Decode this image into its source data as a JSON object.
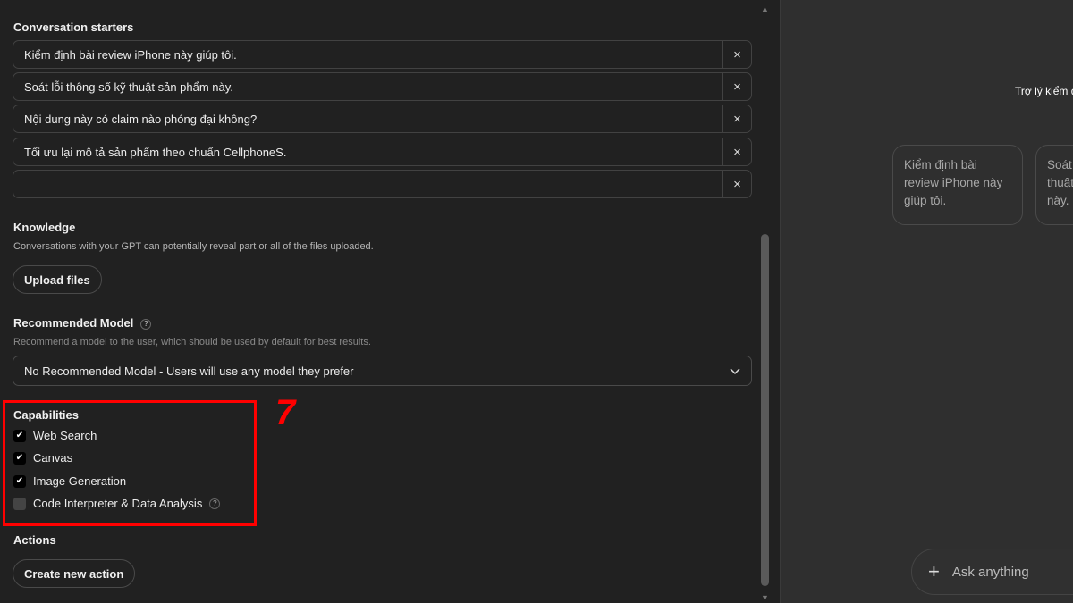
{
  "starters": {
    "heading": "Conversation starters",
    "items": [
      "Kiểm định bài review iPhone này giúp tôi.",
      "Soát lỗi thông số kỹ thuật sản phẩm này.",
      "Nội dung này có claim nào phóng đại không?",
      "Tối ưu lại mô tả sản phẩm theo chuẩn CellphoneS.",
      ""
    ],
    "remove_icon": "×"
  },
  "knowledge": {
    "heading": "Knowledge",
    "description": "Conversations with your GPT can potentially reveal part or all of the files uploaded.",
    "upload_label": "Upload files"
  },
  "model": {
    "heading": "Recommended Model",
    "description": "Recommend a model to the user, which should be used by default for best results.",
    "selected": "No Recommended Model - Users will use any model they prefer"
  },
  "capabilities": {
    "heading": "Capabilities",
    "items": [
      {
        "label": "Web Search",
        "checked": true
      },
      {
        "label": "Canvas",
        "checked": true
      },
      {
        "label": "Image Generation",
        "checked": true
      },
      {
        "label": "Code Interpreter & Data Analysis",
        "checked": false
      }
    ]
  },
  "actions": {
    "heading": "Actions",
    "create_label": "Create new action"
  },
  "annotation": {
    "step": "7",
    "color": "#ff0000"
  },
  "preview": {
    "title": "Trợ lý kiểm đ",
    "cards": [
      "Kiểm định bài review iPhone này giúp tôi.",
      "Soát lỗi thông số kỹ thuật sản phẩm này."
    ],
    "ask_placeholder": "Ask anything"
  }
}
